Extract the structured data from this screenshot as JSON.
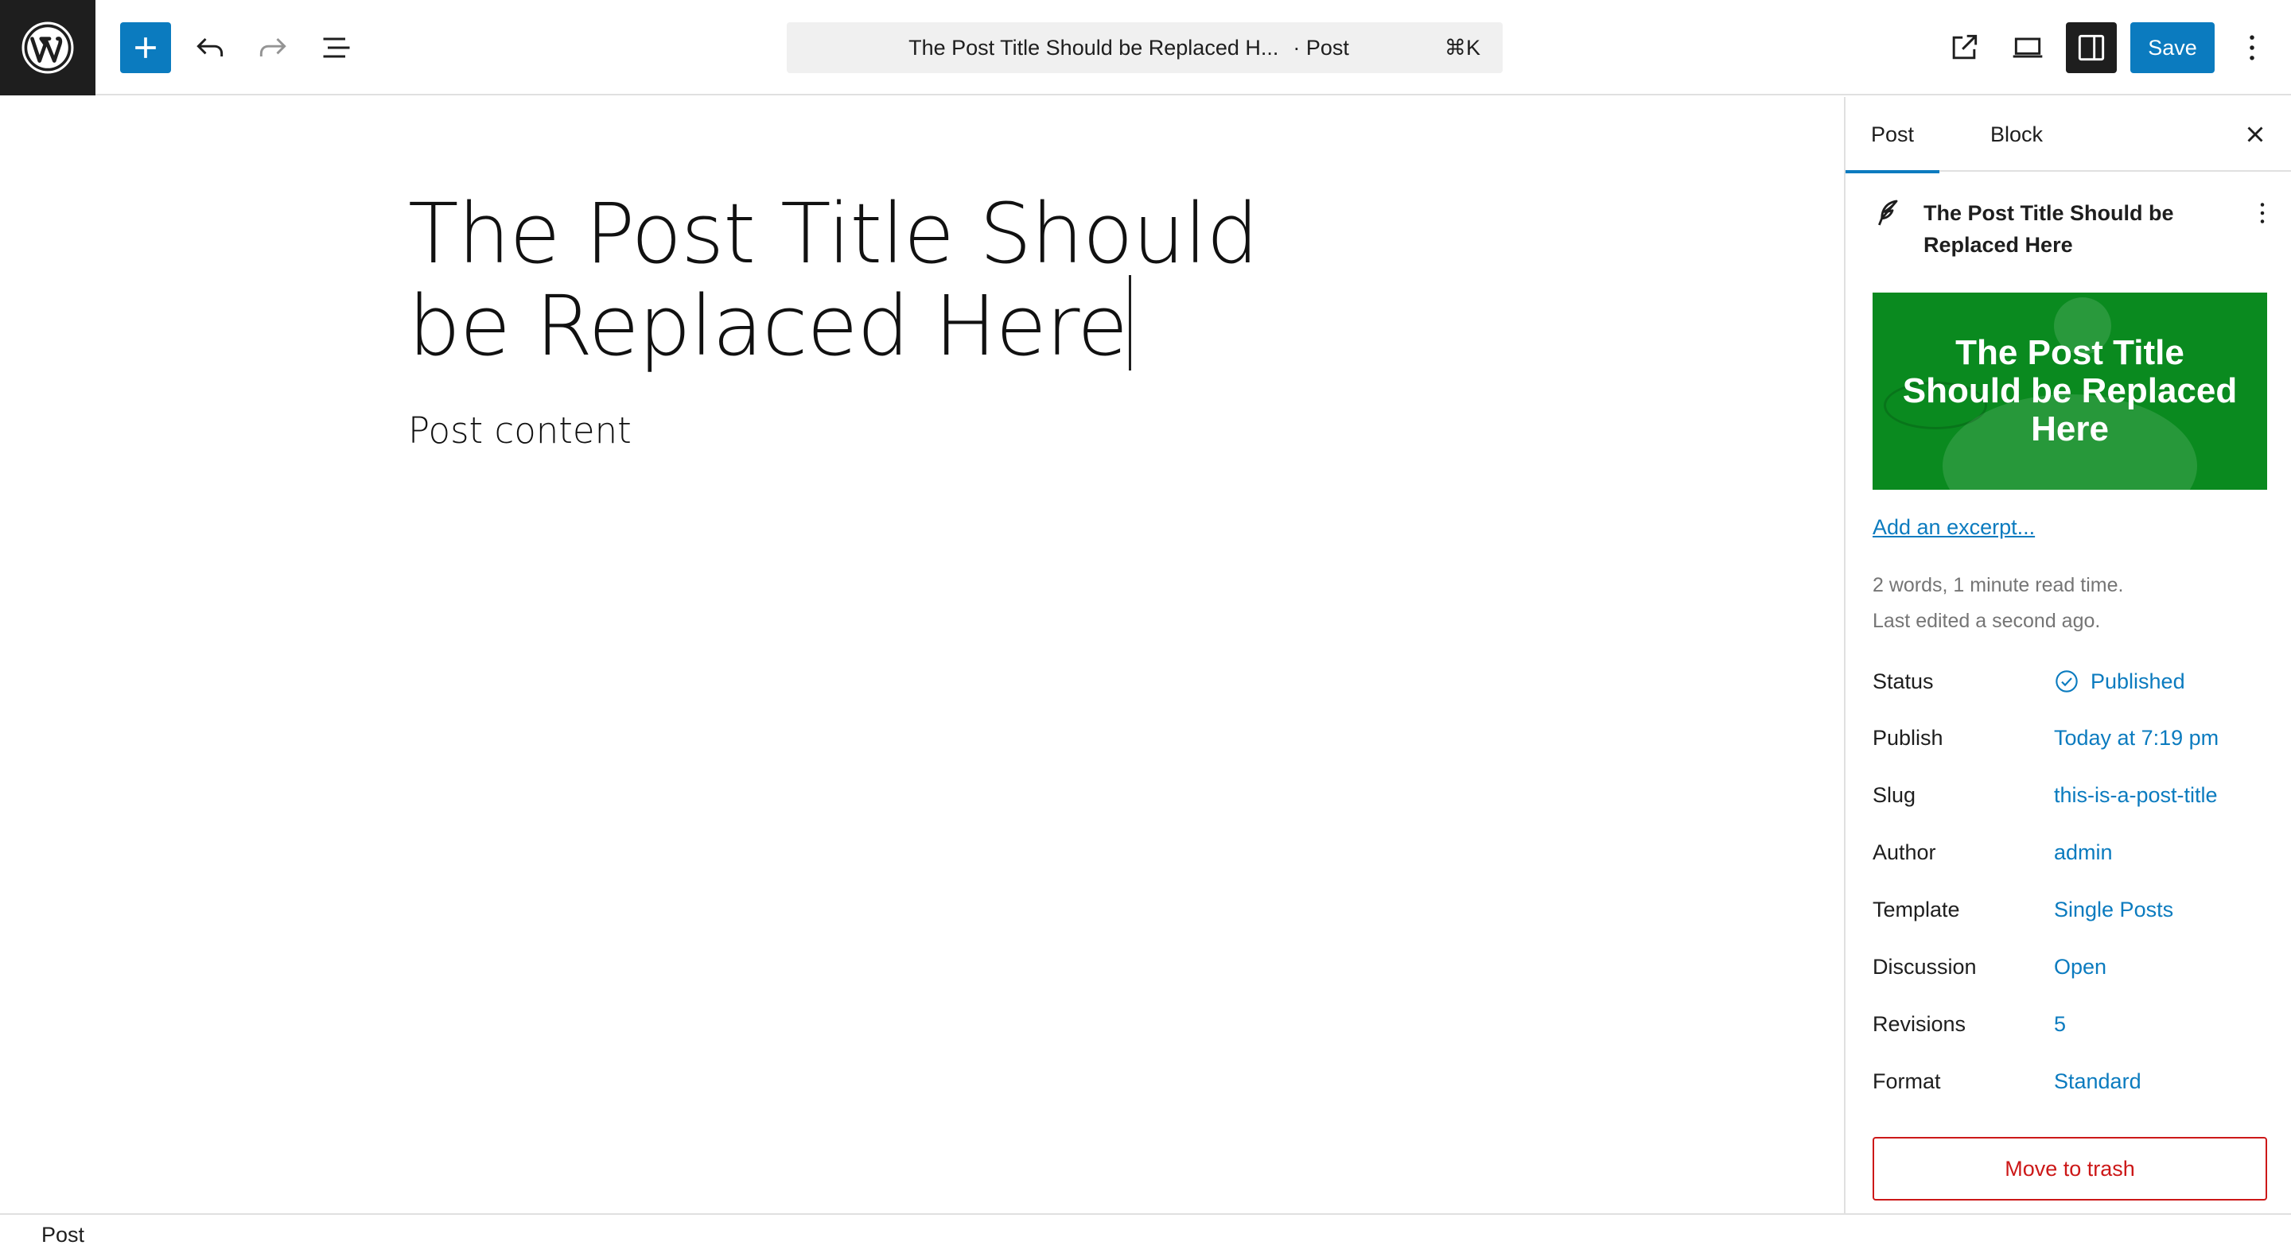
{
  "toolbar": {
    "doc_title": "The Post Title Should be Replaced H...",
    "doc_type": "· Post",
    "shortcut": "⌘K",
    "save_label": "Save",
    "accent": "#0b7bbf",
    "icons": [
      "wordpress-logo-icon",
      "plus-icon",
      "undo-icon",
      "redo-icon",
      "list-view-icon",
      "external-link-icon",
      "desktop-preview-icon",
      "sidebar-toggle-icon",
      "more-vertical-icon"
    ]
  },
  "editor": {
    "title": "The Post Title Should be Replaced Here",
    "content_placeholder": "Post content"
  },
  "sidebar": {
    "tabs": [
      {
        "label": "Post",
        "active": true
      },
      {
        "label": "Block",
        "active": false
      }
    ],
    "card_title": "The Post Title Should be Replaced Here",
    "featured_image_text": "The Post Title Should be Replaced Here",
    "featured_image_bg": "#0a8a1f",
    "excerpt_link": "Add an excerpt...",
    "meta_words": "2 words, 1 minute read time.",
    "meta_edited": "Last edited a second ago.",
    "fields": [
      {
        "label": "Status",
        "value": "Published"
      },
      {
        "label": "Publish",
        "value": "Today at 7:19 pm"
      },
      {
        "label": "Slug",
        "value": "this-is-a-post-title"
      },
      {
        "label": "Author",
        "value": "admin"
      },
      {
        "label": "Template",
        "value": "Single Posts"
      },
      {
        "label": "Discussion",
        "value": "Open"
      },
      {
        "label": "Revisions",
        "value": "5"
      },
      {
        "label": "Format",
        "value": "Standard"
      }
    ],
    "trash_label": "Move to trash",
    "danger_color": "#cc1818"
  },
  "footer": {
    "breadcrumb": "Post"
  }
}
